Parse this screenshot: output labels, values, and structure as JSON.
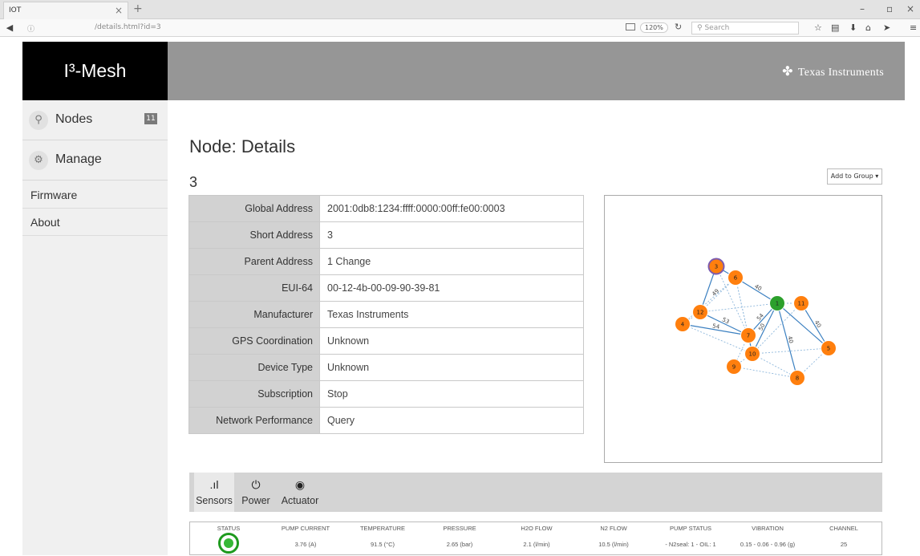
{
  "browser": {
    "tab_title": "IOT",
    "url": "/details.html?id=3",
    "zoom": "120%",
    "search_placeholder": "Search"
  },
  "app": {
    "brand": "I³-Mesh",
    "company": "Texas Instruments"
  },
  "sidebar": {
    "items": [
      {
        "label": "Nodes",
        "badge": "11",
        "icon": "nodes-icon"
      },
      {
        "label": "Manage",
        "icon": "gear-icon"
      }
    ],
    "links": [
      "Firmware",
      "About"
    ]
  },
  "page": {
    "title": "Node: Details",
    "node_id": "3",
    "add_group_label": "Add to Group ▾"
  },
  "details": [
    {
      "key": "Global Address",
      "value": "2001:0db8:1234:ffff:0000:00ff:fe00:0003"
    },
    {
      "key": "Short Address",
      "value": "3"
    },
    {
      "key": "Parent Address",
      "value": "1  Change"
    },
    {
      "key": "EUI-64",
      "value": "00-12-4b-00-09-90-39-81"
    },
    {
      "key": "Manufacturer",
      "value": "Texas Instruments"
    },
    {
      "key": "GPS Coordination",
      "value": "Unknown"
    },
    {
      "key": "Device Type",
      "value": "Unknown"
    },
    {
      "key": "Subscription",
      "value": "Stop"
    },
    {
      "key": "Network Performance",
      "value": "Query"
    }
  ],
  "graph": {
    "nodes": [
      {
        "id": "1",
        "color": "#2ca02c"
      },
      {
        "id": "3",
        "color": "#ff7f0e"
      },
      {
        "id": "4",
        "color": "#ff7f0e"
      },
      {
        "id": "5",
        "color": "#ff7f0e"
      },
      {
        "id": "6",
        "color": "#ff7f0e"
      },
      {
        "id": "7",
        "color": "#ff7f0e"
      },
      {
        "id": "8",
        "color": "#ff7f0e"
      },
      {
        "id": "9",
        "color": "#ff7f0e"
      },
      {
        "id": "10",
        "color": "#ff7f0e"
      },
      {
        "id": "11",
        "color": "#ff7f0e"
      },
      {
        "id": "12",
        "color": "#ff7f0e"
      }
    ],
    "edges": [
      {
        "source": "3",
        "target": "6",
        "label": ""
      },
      {
        "source": "3",
        "target": "12",
        "label": ""
      },
      {
        "source": "3",
        "target": "7",
        "label": ""
      },
      {
        "source": "6",
        "target": "1",
        "label": "40"
      },
      {
        "source": "6",
        "target": "12",
        "label": "49"
      },
      {
        "source": "6",
        "target": "7",
        "label": ""
      },
      {
        "source": "6",
        "target": "10",
        "label": ""
      },
      {
        "source": "6",
        "target": "4",
        "label": ""
      },
      {
        "source": "1",
        "target": "7",
        "label": "54"
      },
      {
        "source": "1",
        "target": "10",
        "label": "50"
      },
      {
        "source": "1",
        "target": "5",
        "label": ""
      },
      {
        "source": "1",
        "target": "8",
        "label": "40"
      },
      {
        "source": "1",
        "target": "11",
        "label": ""
      },
      {
        "source": "1",
        "target": "12",
        "label": ""
      },
      {
        "source": "11",
        "target": "5",
        "label": "40"
      },
      {
        "source": "11",
        "target": "10",
        "label": ""
      },
      {
        "source": "12",
        "target": "7",
        "label": "53"
      },
      {
        "source": "12",
        "target": "4",
        "label": ""
      },
      {
        "source": "4",
        "target": "7",
        "label": "54"
      },
      {
        "source": "4",
        "target": "10",
        "label": ""
      },
      {
        "source": "7",
        "target": "10",
        "label": ""
      },
      {
        "source": "7",
        "target": "9",
        "label": ""
      },
      {
        "source": "10",
        "target": "5",
        "label": ""
      },
      {
        "source": "10",
        "target": "9",
        "label": ""
      },
      {
        "source": "10",
        "target": "8",
        "label": ""
      },
      {
        "source": "9",
        "target": "8",
        "label": ""
      },
      {
        "source": "8",
        "target": "5",
        "label": ""
      }
    ]
  },
  "bottom_tabs": [
    {
      "label": "Sensors",
      "icon": "signal-icon"
    },
    {
      "label": "Power",
      "icon": "power-icon"
    },
    {
      "label": "Actuator",
      "icon": "toggle-icon"
    }
  ],
  "sensors": {
    "headers": [
      "STATUS",
      "PUMP CURRENT",
      "TEMPERATURE",
      "PRESSURE",
      "H2O FLOW",
      "N2 FLOW",
      "PUMP STATUS",
      "VIBRATION",
      "CHANNEL"
    ],
    "values": [
      "",
      "3.76 (A)",
      "91.5 (°C)",
      "2.65 (bar)",
      "2.1 (l/min)",
      "10.5 (l/min)",
      "- N2seal: 1 - OIL: 1",
      "0.15 - 0.06 - 0.96 (g)",
      "25"
    ]
  }
}
